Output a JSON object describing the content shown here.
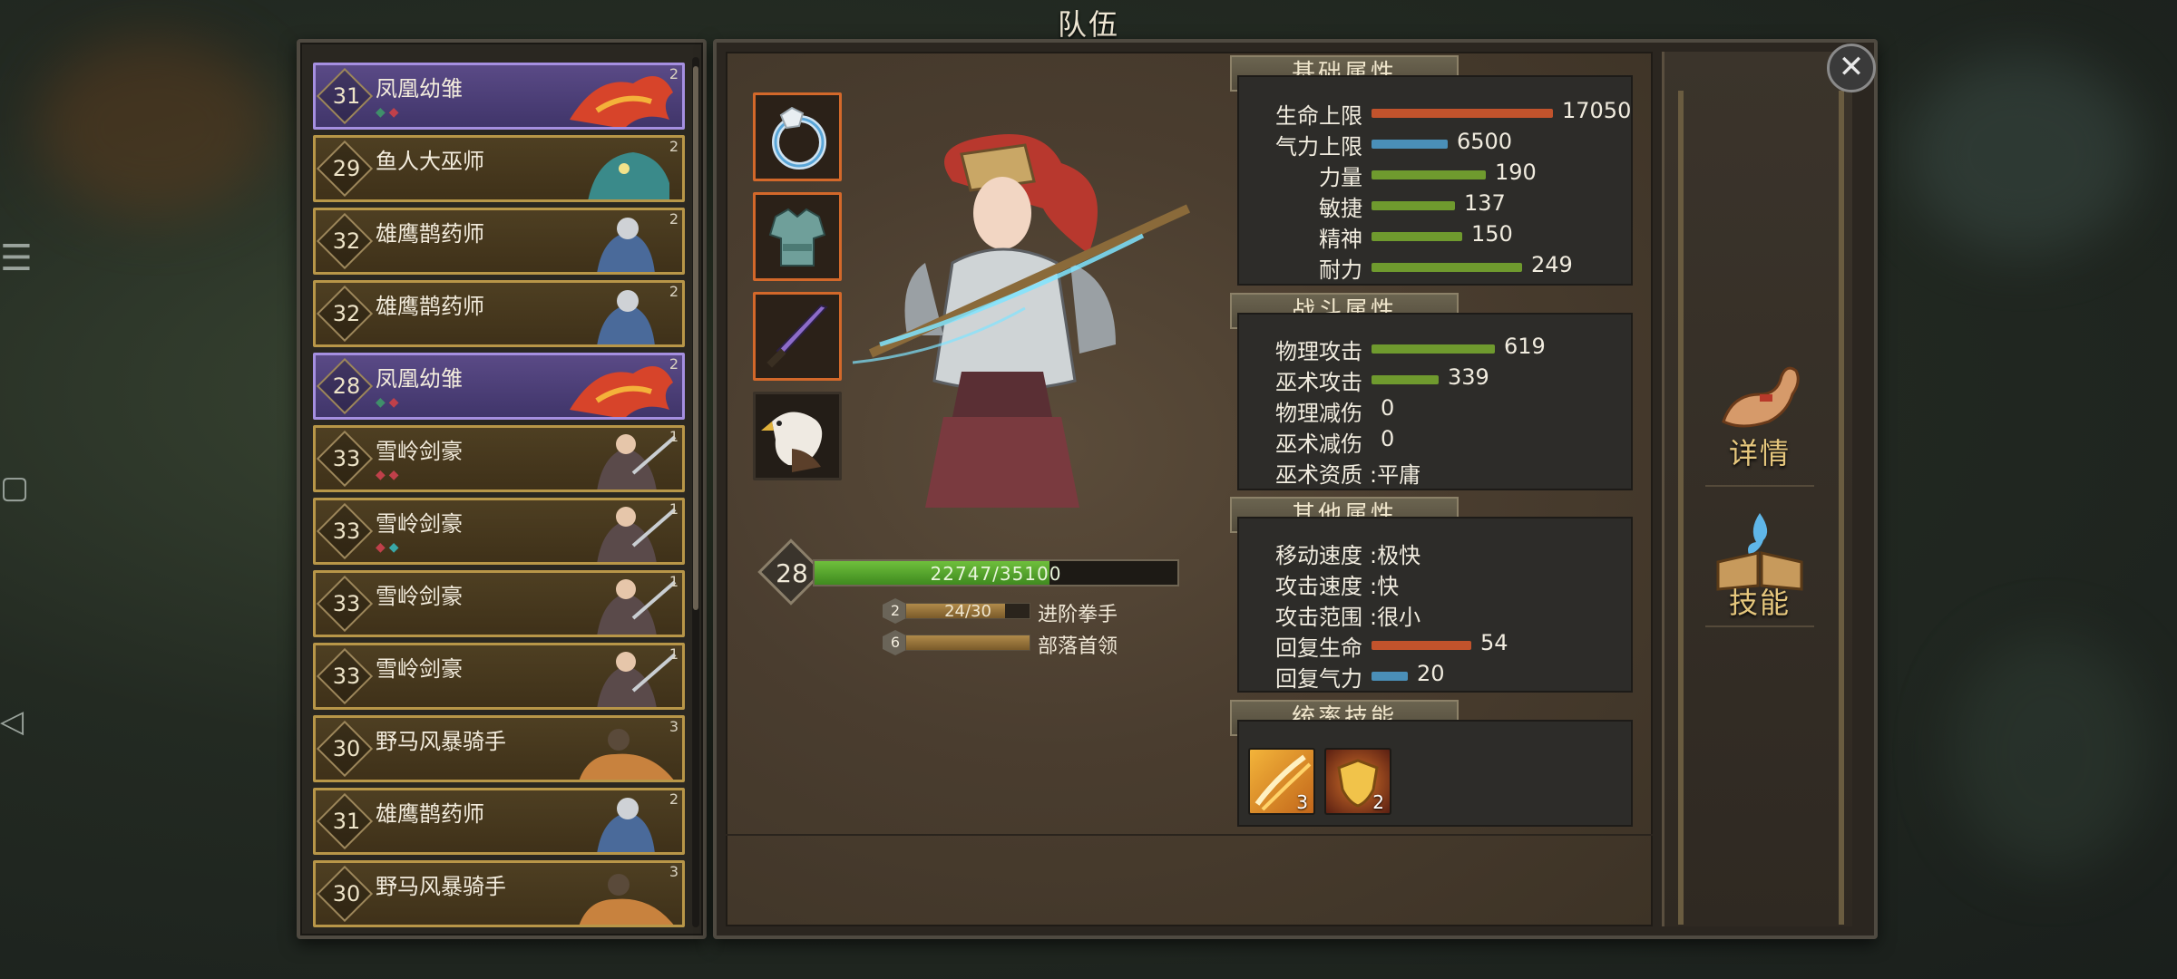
{
  "window": {
    "title": "队伍"
  },
  "roster": [
    {
      "level": "31",
      "name": "凤凰幼雏",
      "stars": "2",
      "gems": [
        "g",
        "r"
      ],
      "selected": true,
      "portrait": "phoenix"
    },
    {
      "level": "29",
      "name": "鱼人大巫师",
      "stars": "2",
      "gems": [],
      "selected": false,
      "portrait": "murloc"
    },
    {
      "level": "32",
      "name": "雄鹰鹊药师",
      "stars": "2",
      "gems": [],
      "selected": false,
      "portrait": "healer"
    },
    {
      "level": "32",
      "name": "雄鹰鹊药师",
      "stars": "2",
      "gems": [],
      "selected": false,
      "portrait": "healer"
    },
    {
      "level": "28",
      "name": "凤凰幼雏",
      "stars": "2",
      "gems": [
        "g",
        "r"
      ],
      "selected": true,
      "portrait": "phoenix"
    },
    {
      "level": "33",
      "name": "雪岭剑豪",
      "stars": "1",
      "gems": [
        "r",
        "r"
      ],
      "selected": false,
      "portrait": "swordsman"
    },
    {
      "level": "33",
      "name": "雪岭剑豪",
      "stars": "1",
      "gems": [
        "r",
        "t"
      ],
      "selected": false,
      "portrait": "swordsman"
    },
    {
      "level": "33",
      "name": "雪岭剑豪",
      "stars": "1",
      "gems": [],
      "selected": false,
      "portrait": "swordsman"
    },
    {
      "level": "33",
      "name": "雪岭剑豪",
      "stars": "1",
      "gems": [],
      "selected": false,
      "portrait": "swordsman"
    },
    {
      "level": "30",
      "name": "野马风暴骑手",
      "stars": "3",
      "gems": [],
      "selected": false,
      "portrait": "rider"
    },
    {
      "level": "31",
      "name": "雄鹰鹊药师",
      "stars": "2",
      "gems": [],
      "selected": false,
      "portrait": "healer"
    },
    {
      "level": "30",
      "name": "野马风暴骑手",
      "stars": "3",
      "gems": [],
      "selected": false,
      "portrait": "rider"
    }
  ],
  "hero": {
    "level": "28",
    "xp_text": "22747/35100",
    "xp_fraction": 0.648,
    "progress": [
      {
        "icon_text": "2",
        "bar_text": "24/30",
        "fraction": 0.8,
        "label": "进阶拳手"
      },
      {
        "icon_text": "6",
        "bar_text": "",
        "fraction": 1.0,
        "label": "部落首领"
      }
    ]
  },
  "equipment": [
    {
      "icon": "ring-icon"
    },
    {
      "icon": "armor-icon"
    },
    {
      "icon": "dagger-icon"
    },
    {
      "icon": "eagle-icon"
    }
  ],
  "sections": {
    "basic": "基础属性",
    "combat": "战斗属性",
    "other": "其他属性",
    "command": "统率技能"
  },
  "basic_stats": [
    {
      "label": "生命上限",
      "value": "17050",
      "bar": 1.0,
      "color": "#c2532c"
    },
    {
      "label": "气力上限",
      "value": "6500",
      "bar": 0.42,
      "color": "#4a8fb8"
    },
    {
      "label": "力量",
      "value": "190",
      "bar": 0.63,
      "color": "#6f9a2e"
    },
    {
      "label": "敏捷",
      "value": "137",
      "bar": 0.46,
      "color": "#6f9a2e"
    },
    {
      "label": "精神",
      "value": "150",
      "bar": 0.5,
      "color": "#6f9a2e"
    },
    {
      "label": "耐力",
      "value": "249",
      "bar": 0.83,
      "color": "#6f9a2e"
    }
  ],
  "combat_stats": [
    {
      "label": "物理攻击",
      "value": "619",
      "bar": 0.68,
      "color": "#6f9a2e"
    },
    {
      "label": "巫术攻击",
      "value": "339",
      "bar": 0.37,
      "color": "#6f9a2e"
    },
    {
      "label": "物理减伤",
      "value": "0",
      "bar": 0,
      "color": "#6f9a2e"
    },
    {
      "label": "巫术减伤",
      "value": "0",
      "bar": 0,
      "color": "#6f9a2e"
    },
    {
      "label": "巫术资质",
      "value": ":平庸",
      "bar": null,
      "color": ""
    }
  ],
  "other_stats": [
    {
      "label": "移动速度",
      "value": ":极快",
      "bar": null,
      "color": ""
    },
    {
      "label": "攻击速度",
      "value": ":快",
      "bar": null,
      "color": ""
    },
    {
      "label": "攻击范围",
      "value": ":很小",
      "bar": null,
      "color": ""
    },
    {
      "label": "回复生命",
      "value": "54",
      "bar": 0.55,
      "color": "#c2532c"
    },
    {
      "label": "回复气力",
      "value": "20",
      "bar": 0.2,
      "color": "#4a8fb8"
    }
  ],
  "command_skills": [
    {
      "icon": "slash-skill-icon",
      "count": "3"
    },
    {
      "icon": "shield-skill-icon",
      "count": "2"
    }
  ],
  "side_buttons": [
    {
      "label": "详情",
      "icon": "flexed-arm-icon"
    },
    {
      "label": "技能",
      "icon": "spellbook-icon"
    }
  ]
}
